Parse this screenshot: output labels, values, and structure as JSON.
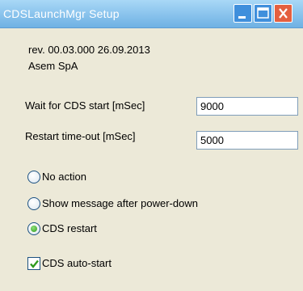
{
  "window": {
    "title": "CDSLaunchMgr Setup"
  },
  "header": {
    "revision": "rev. 00.03.000 26.09.2013",
    "company": "Asem SpA"
  },
  "fields": {
    "wait_label": "Wait for CDS start [mSec]",
    "wait_value": "9000",
    "restart_label": "Restart time-out [mSec]",
    "restart_value": "5000"
  },
  "options": {
    "no_action": "No action",
    "show_message": "Show message after power-down",
    "cds_restart": "CDS restart",
    "selected": "cds_restart"
  },
  "autostart": {
    "label": "CDS auto-start",
    "checked": true
  },
  "colors": {
    "title_bar": "#8ec6ee",
    "close": "#e45f40",
    "check": "#2f9a1d"
  }
}
